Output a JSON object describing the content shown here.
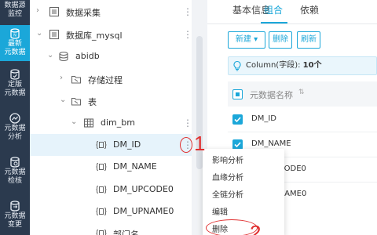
{
  "rail": {
    "items": [
      {
        "label_lines": [
          "数据源",
          "监控"
        ],
        "icon": "monitor-icon",
        "active": false
      },
      {
        "label_lines": [
          "最新",
          "元数据"
        ],
        "icon": "new-metadata-icon",
        "active": true
      },
      {
        "label_lines": [
          "定版",
          "元数据"
        ],
        "icon": "release-metadata-icon",
        "active": false
      },
      {
        "label_lines": [
          "元数据",
          "分析"
        ],
        "icon": "analysis-icon",
        "active": false
      },
      {
        "label_lines": [
          "元数据",
          "检核"
        ],
        "icon": "check-icon",
        "active": false
      },
      {
        "label_lines": [
          "元数据",
          "变更"
        ],
        "icon": "change-icon",
        "active": false
      }
    ]
  },
  "tree": {
    "nodes": [
      {
        "label": "数据采集",
        "icon": "folder-list-icon",
        "arrow": "›",
        "selected": false
      },
      {
        "label": "数据库_mysql",
        "icon": "folder-list-icon",
        "arrow": "⌄",
        "selected": false
      },
      {
        "label": "abidb",
        "icon": "database-icon",
        "arrow": "⌄",
        "selected": false
      },
      {
        "label": "存储过程",
        "icon": "procedure-folder-icon",
        "arrow": "›",
        "selected": false
      },
      {
        "label": "表",
        "icon": "table-folder-icon",
        "arrow": "⌄",
        "selected": false
      },
      {
        "label": "dim_bm",
        "icon": "table-icon",
        "arrow": "⌄",
        "selected": false
      },
      {
        "label": "DM_ID",
        "icon": "column-icon",
        "arrow": "",
        "selected": true
      },
      {
        "label": "DM_NAME",
        "icon": "column-icon",
        "arrow": "",
        "selected": false
      },
      {
        "label": "DM_UPCODE0",
        "icon": "column-icon",
        "arrow": "",
        "selected": false
      },
      {
        "label": "DM_UPNAME0",
        "icon": "column-icon",
        "arrow": "",
        "selected": false
      },
      {
        "label": "部门名",
        "icon": "column-icon",
        "arrow": "",
        "selected": false
      }
    ],
    "more_glyph": "⋮"
  },
  "callouts": {
    "first": "1",
    "second": "2"
  },
  "context_menu": {
    "items": [
      "影响分析",
      "血缘分析",
      "全链分析",
      "编辑",
      "删除"
    ]
  },
  "right": {
    "tabs": [
      "基本信息",
      "组合",
      "依赖"
    ],
    "active_tab": "组合",
    "buttons": {
      "new": "新建 ▾",
      "delete": "删除",
      "refresh": "刷新"
    },
    "info_prefix": "Column(字段): ",
    "info_count": "10个",
    "table": {
      "header": "元数据名称",
      "sort_glyph": "⇅",
      "rows": [
        "DM_ID",
        "DM_NAME",
        "DM_UPCODE0",
        "DM_UPNAME0"
      ]
    }
  },
  "colors": {
    "accent": "#1ba7d9",
    "rail": "#2b3a4e",
    "callout": "#e03030"
  }
}
